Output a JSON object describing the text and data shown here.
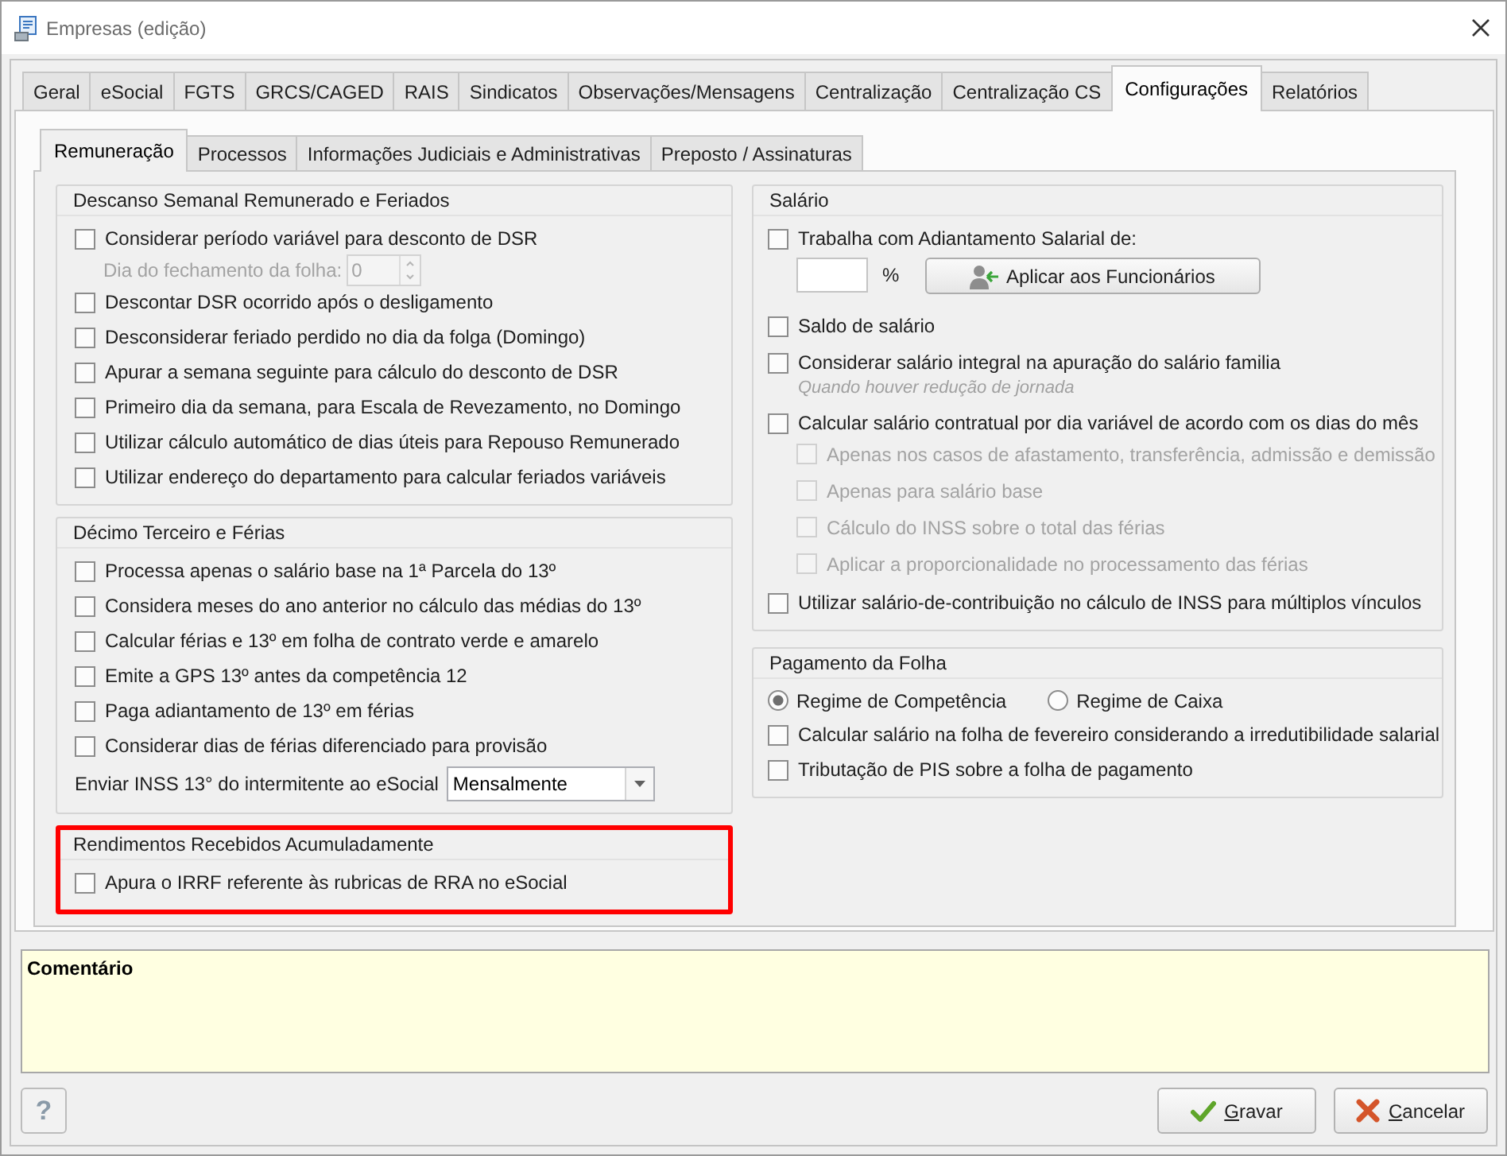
{
  "window": {
    "title": "Empresas (edição)"
  },
  "tabs": [
    {
      "label": "Geral",
      "selected": false
    },
    {
      "label": "eSocial",
      "selected": false
    },
    {
      "label": "FGTS",
      "selected": false
    },
    {
      "label": "GRCS/CAGED",
      "selected": false
    },
    {
      "label": "RAIS",
      "selected": false
    },
    {
      "label": "Sindicatos",
      "selected": false
    },
    {
      "label": "Observações/Mensagens",
      "selected": false
    },
    {
      "label": "Centralização",
      "selected": false
    },
    {
      "label": "Centralização CS",
      "selected": false
    },
    {
      "label": "Configurações",
      "selected": true
    },
    {
      "label": "Relatórios",
      "selected": false
    }
  ],
  "subtabs": [
    {
      "label": "Remuneração",
      "selected": true
    },
    {
      "label": "Processos",
      "selected": false
    },
    {
      "label": "Informações Judiciais e Administrativas",
      "selected": false
    },
    {
      "label": "Preposto / Assinaturas",
      "selected": false
    }
  ],
  "left_groups": [
    {
      "title": "Descanso Semanal Remunerado e Feriados",
      "highlighted": false,
      "items": [
        {
          "kind": "checkbox",
          "label": "Considerar período variável para desconto de DSR",
          "checked": false,
          "children": [
            {
              "kind": "spinner",
              "label": "Dia do fechamento da folha:",
              "value": "0",
              "disabled": true
            }
          ]
        },
        {
          "kind": "checkbox",
          "label": "Descontar DSR ocorrido após o desligamento",
          "checked": false
        },
        {
          "kind": "checkbox",
          "label": "Desconsiderar feriado perdido no dia da folga (Domingo)",
          "checked": false
        },
        {
          "kind": "checkbox",
          "label": "Apurar a semana seguinte para cálculo do desconto de DSR",
          "checked": false
        },
        {
          "kind": "checkbox",
          "label": "Primeiro dia da semana, para Escala de Revezamento, no Domingo",
          "checked": false
        },
        {
          "kind": "checkbox",
          "label": "Utilizar cálculo automático de dias úteis para Repouso Remunerado",
          "checked": false
        },
        {
          "kind": "checkbox",
          "label": "Utilizar endereço do departamento para calcular feriados variáveis",
          "checked": false
        }
      ]
    },
    {
      "title": "Décimo Terceiro e Férias",
      "highlighted": false,
      "items": [
        {
          "kind": "checkbox",
          "label": "Processa apenas o salário base na 1ª Parcela do 13º",
          "checked": false
        },
        {
          "kind": "checkbox",
          "label": "Considera meses do ano anterior no cálculo das médias do 13º",
          "checked": false
        },
        {
          "kind": "checkbox",
          "label": "Calcular férias e 13º em folha de contrato verde e amarelo",
          "checked": false
        },
        {
          "kind": "checkbox",
          "label": "Emite a GPS 13º antes da competência 12",
          "checked": false
        },
        {
          "kind": "checkbox",
          "label": "Paga adiantamento de 13º em férias",
          "checked": false
        },
        {
          "kind": "checkbox",
          "label": "Considerar dias de férias diferenciado para provisão",
          "checked": false
        },
        {
          "kind": "select",
          "label": "Enviar INSS 13° do intermitente ao eSocial",
          "value": "Mensalmente"
        }
      ]
    },
    {
      "title": "Rendimentos Recebidos Acumuladamente",
      "highlighted": true,
      "items": [
        {
          "kind": "checkbox",
          "label": "Apura o IRRF referente às rubricas de RRA no eSocial",
          "checked": false
        }
      ]
    }
  ],
  "right_groups": [
    {
      "title": "Salário",
      "items": [
        {
          "kind": "checkbox",
          "label": "Trabalha com Adiantamento Salarial de:",
          "checked": false,
          "children": [
            {
              "kind": "percent_apply",
              "unit": "%",
              "button": "Aplicar aos Funcionários"
            }
          ]
        },
        {
          "kind": "checkbox",
          "label": "Saldo de salário",
          "checked": false
        },
        {
          "kind": "checkbox",
          "label": "Considerar salário integral na apuração do salário familia",
          "checked": false,
          "hint": "Quando houver redução de jornada"
        },
        {
          "kind": "checkbox",
          "label": "Calcular salário contratual por dia variável de acordo com os dias do mês",
          "checked": false,
          "children": [
            {
              "kind": "checkbox",
              "label": "Apenas nos casos de afastamento, transferência, admissão e demissão",
              "checked": false,
              "disabled": true
            },
            {
              "kind": "checkbox",
              "label": "Apenas para salário base",
              "checked": false,
              "disabled": true
            },
            {
              "kind": "checkbox",
              "label": "Cálculo do INSS sobre o total das férias",
              "checked": false,
              "disabled": true
            },
            {
              "kind": "checkbox",
              "label": "Aplicar a proporcionalidade no processamento das férias",
              "checked": false,
              "disabled": true
            }
          ]
        },
        {
          "kind": "checkbox",
          "label": "Utilizar salário-de-contribuição no cálculo de INSS para múltiplos vínculos",
          "checked": false
        }
      ]
    },
    {
      "title": "Pagamento da Folha",
      "items": [
        {
          "kind": "radios",
          "options": [
            {
              "label": "Regime de Competência",
              "selected": true
            },
            {
              "label": "Regime de Caixa",
              "selected": false
            }
          ]
        },
        {
          "kind": "checkbox",
          "label": "Calcular salário na folha de fevereiro considerando a irredutibilidade salarial",
          "checked": false
        },
        {
          "kind": "checkbox",
          "label": "Tributação de PIS sobre a folha de pagamento",
          "checked": false
        }
      ]
    }
  ],
  "comment": {
    "label": "Comentário"
  },
  "buttons": [
    {
      "kind": "help",
      "label": "?"
    },
    {
      "kind": "save",
      "label": "Gravar"
    },
    {
      "kind": "cancel",
      "label": "Cancelar"
    }
  ]
}
